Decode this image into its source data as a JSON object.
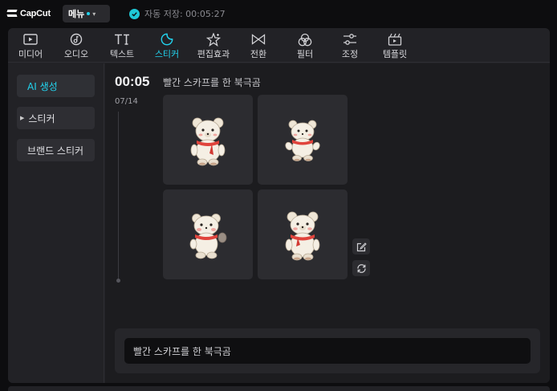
{
  "app": {
    "logo": "CapCut"
  },
  "menu": {
    "label": "메뉴"
  },
  "autosave": {
    "text": "자동 저장: 00:05:27"
  },
  "tabs": [
    {
      "id": "media",
      "label": "미디어",
      "icon": "media-icon"
    },
    {
      "id": "audio",
      "label": "오디오",
      "icon": "audio-icon"
    },
    {
      "id": "text",
      "label": "텍스트",
      "icon": "text-icon"
    },
    {
      "id": "sticker",
      "label": "스티커",
      "icon": "sticker-icon",
      "active": true
    },
    {
      "id": "effects",
      "label": "편집효과",
      "icon": "effects-icon"
    },
    {
      "id": "transition",
      "label": "전환",
      "icon": "transition-icon"
    },
    {
      "id": "filter",
      "label": "필터",
      "icon": "filter-icon"
    },
    {
      "id": "adjust",
      "label": "조정",
      "icon": "adjust-icon"
    },
    {
      "id": "template",
      "label": "템플릿",
      "icon": "template-icon"
    }
  ],
  "sidebar": {
    "items": [
      {
        "label": "AI 생성",
        "active": true
      },
      {
        "label": "스티커"
      },
      {
        "label": "브랜드 스티커"
      }
    ]
  },
  "generation": {
    "time": "00:05",
    "prompt": "빨간 스카프를 한 북극곰",
    "counter": "07/14"
  },
  "results": [
    {
      "name": "polar-bear-sticker-1"
    },
    {
      "name": "polar-bear-sticker-2"
    },
    {
      "name": "polar-bear-sticker-3"
    },
    {
      "name": "polar-bear-sticker-4"
    }
  ],
  "input": {
    "value": "빨간 스카프를 한 북극곰"
  },
  "colors": {
    "accent": "#22d3ee",
    "panel": "#222226",
    "content": "#1c1c1f",
    "scarf": "#e0443c",
    "bear": "#f3ece0"
  }
}
